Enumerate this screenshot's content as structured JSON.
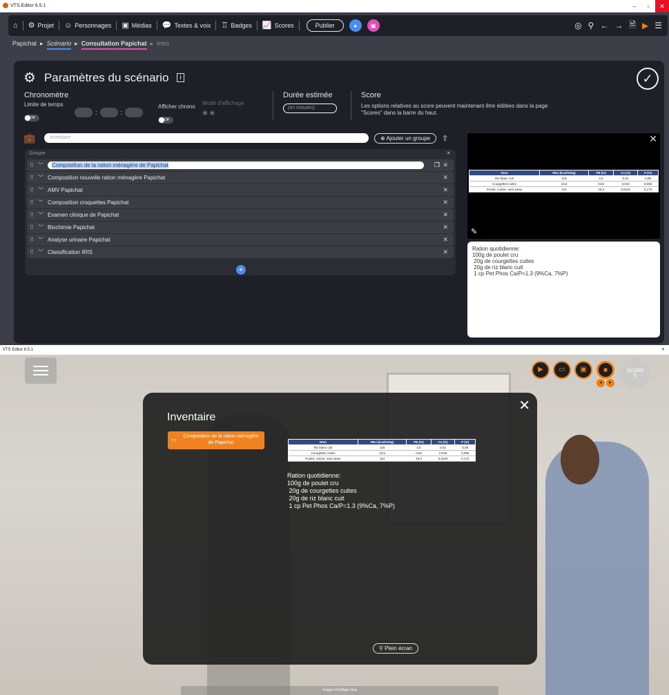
{
  "app_title": "VTS Editor 6.5.1",
  "colors": {
    "accent": "#4a8df0",
    "pink": "#e04fb6",
    "orange": "#f08320"
  },
  "nav": {
    "home_icon": "home-icon",
    "items": [
      "Projet",
      "Personnages",
      "Médias",
      "Textes & voix",
      "Badges",
      "Scores"
    ],
    "publish": "Publier"
  },
  "breadcrumb": [
    "Papichat",
    "Scénario",
    "Consultation Papichat",
    "Intro"
  ],
  "panel": {
    "title": "Paramètres du scénario",
    "chrono_title": "Chronomètre",
    "limit_label": "Limite de temps",
    "toggle_off": "Off",
    "show_chrono_label": "Afficher chrono",
    "mode_label": "Mode d'affichage",
    "duration_title": "Durée estimée",
    "duration_placeholder": "(en minutes)",
    "score_title": "Score",
    "score_text": "Les options relatives au score peuvent maintenant être éditées dans la page \"Scores\" dans la barre du haut.",
    "inventory_placeholder": "Inventaire",
    "add_group": "Ajouter un groupe",
    "group_header": "Groupe",
    "groups": [
      "Composition de la ration ménagère de Papichat",
      "Composition nouvelle ration ménagère Papichat",
      "AMV Papichat",
      "Composition croquettes Papichat",
      "Examen clinique de Papichat",
      "Biochimie Papichat",
      "Analyse urinaire Papichat",
      "Classification IRIS"
    ]
  },
  "nutrition_table": {
    "headers": [
      "Nom",
      "NRJ (kcal/100g)",
      "PB (%)",
      "Ca (%)",
      "P (%)"
    ],
    "rows": [
      [
        "Riz blanc cuit",
        "115",
        "2,5",
        "0,01",
        "0,08"
      ],
      [
        "Courgettes cuites",
        "15,5",
        "0,93",
        "0,019",
        "0,065"
      ],
      [
        "Poulet, cuisse, sans peau",
        "114",
        "19,3",
        "0,0103",
        "0,173"
      ]
    ]
  },
  "ration_text": "Ration quotidienne:\n100g de poulet cru\n 20g de courgettes cuites\n 20g de riz blanc cuit\n 1 cp Pet Phos Ca/P=1.3 (9%Ca, 7%P)",
  "player": {
    "score_label": "SCORE",
    "score_value": "0",
    "inventory_title": "Inventaire",
    "inventory_item": "Composition de la ration ménagère de Papichat",
    "fullscreen": "Plein écran",
    "caption": "Images ©VetAgro Sup"
  }
}
